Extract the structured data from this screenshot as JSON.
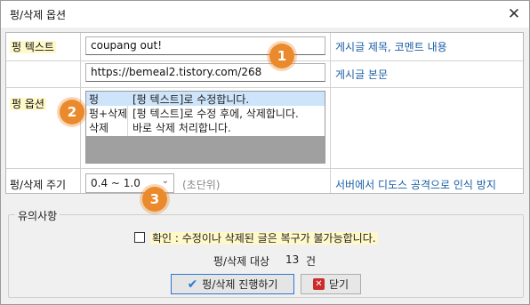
{
  "window": {
    "title": "펑/삭제 옵션"
  },
  "rows": {
    "text_label": "펑 텍스트",
    "text_value": "coupang out!",
    "text_desc": "게시글 제목, 코멘트 내용",
    "url_value": "https://bemeal2.tistory.com/268",
    "url_desc": "게시글 본문",
    "option_label": "펑 옵션",
    "interval_label": "펑/삭제 주기",
    "interval_value": "0.4 ~ 1.0",
    "interval_unit": "(초단위)",
    "interval_desc": "서버에서 디도스 공격으로 인식 방지"
  },
  "options_list": [
    {
      "name": "펑",
      "desc": "[펑 텍스트]로 수정합니다.",
      "selected": true
    },
    {
      "name": "펑+삭제",
      "desc": "[펑 텍스트]로 수정 후에, 삭제합니다.",
      "selected": false
    },
    {
      "name": "삭제",
      "desc": "바로 삭제 처리합니다.",
      "selected": false
    }
  ],
  "badges": [
    "1",
    "2",
    "3"
  ],
  "notice": {
    "title": "유의사항",
    "confirm_label": "확인 : 수정이나 삭제된 글은 복구가 불가능합니다.",
    "count_label": "펑/삭제 대상",
    "count_value": "13",
    "count_unit": "건"
  },
  "buttons": {
    "proceed": "펑/삭제 진행하기",
    "close": "닫기"
  },
  "icons": {
    "close": "close-icon",
    "dropdown": "chevron-down-icon",
    "proceed": "checkmark-icon",
    "cancel": "red-x-icon"
  },
  "colors": {
    "badge": "#ea8a2d",
    "link_text": "#1a5ea6",
    "selection": "#cde4fb",
    "highlight": "#fff8c8"
  }
}
